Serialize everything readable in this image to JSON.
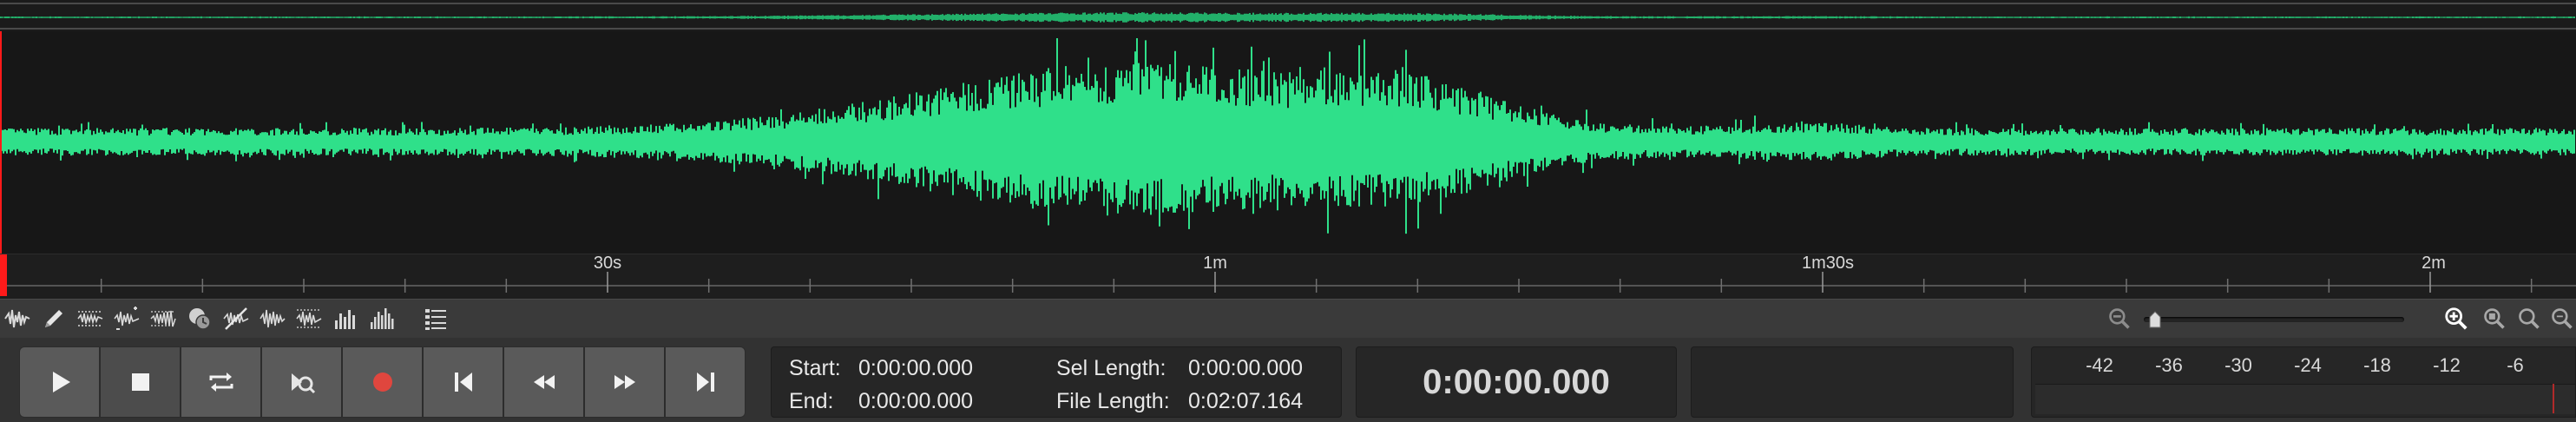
{
  "waveform": {
    "color": "#2fe08a",
    "background": "#171717",
    "playhead_color": "#ff1a1a"
  },
  "ruler": {
    "ticks": [
      "30s",
      "1m",
      "1m30s",
      "2m"
    ]
  },
  "tools": [
    {
      "name": "waveform-view-icon"
    },
    {
      "name": "pencil-icon"
    },
    {
      "name": "normalize-icon"
    },
    {
      "name": "amplify-icon"
    },
    {
      "name": "fade-icon"
    },
    {
      "name": "time-icon"
    },
    {
      "name": "silence-icon"
    },
    {
      "name": "noise-icon"
    },
    {
      "name": "spectrum-icon"
    },
    {
      "name": "bars-icon"
    },
    {
      "name": "bars-alt-icon"
    },
    {
      "name": "list-icon"
    }
  ],
  "zoom": {
    "level": 0.02
  },
  "transport": {
    "buttons": [
      {
        "name": "play-button",
        "icon": "play-icon"
      },
      {
        "name": "stop-button",
        "icon": "stop-icon"
      },
      {
        "name": "loop-button",
        "icon": "loop-icon"
      },
      {
        "name": "scrub-button",
        "icon": "scrub-icon"
      },
      {
        "name": "record-button",
        "icon": "record-icon"
      },
      {
        "name": "skip-start-button",
        "icon": "skip-start-icon"
      },
      {
        "name": "rewind-button",
        "icon": "rewind-icon"
      },
      {
        "name": "fast-forward-button",
        "icon": "fast-forward-icon"
      },
      {
        "name": "skip-end-button",
        "icon": "skip-end-icon"
      }
    ]
  },
  "selection": {
    "start_label": "Start:",
    "start_value": "0:00:00.000",
    "end_label": "End:",
    "end_value": "0:00:00.000",
    "sel_length_label": "Sel Length:",
    "sel_length_value": "0:00:00.000",
    "file_length_label": "File Length:",
    "file_length_value": "0:02:07.164"
  },
  "time_display": "0:00:00.000",
  "meter": {
    "labels": [
      "-42",
      "-36",
      "-30",
      "-24",
      "-18",
      "-12",
      "-6"
    ]
  }
}
